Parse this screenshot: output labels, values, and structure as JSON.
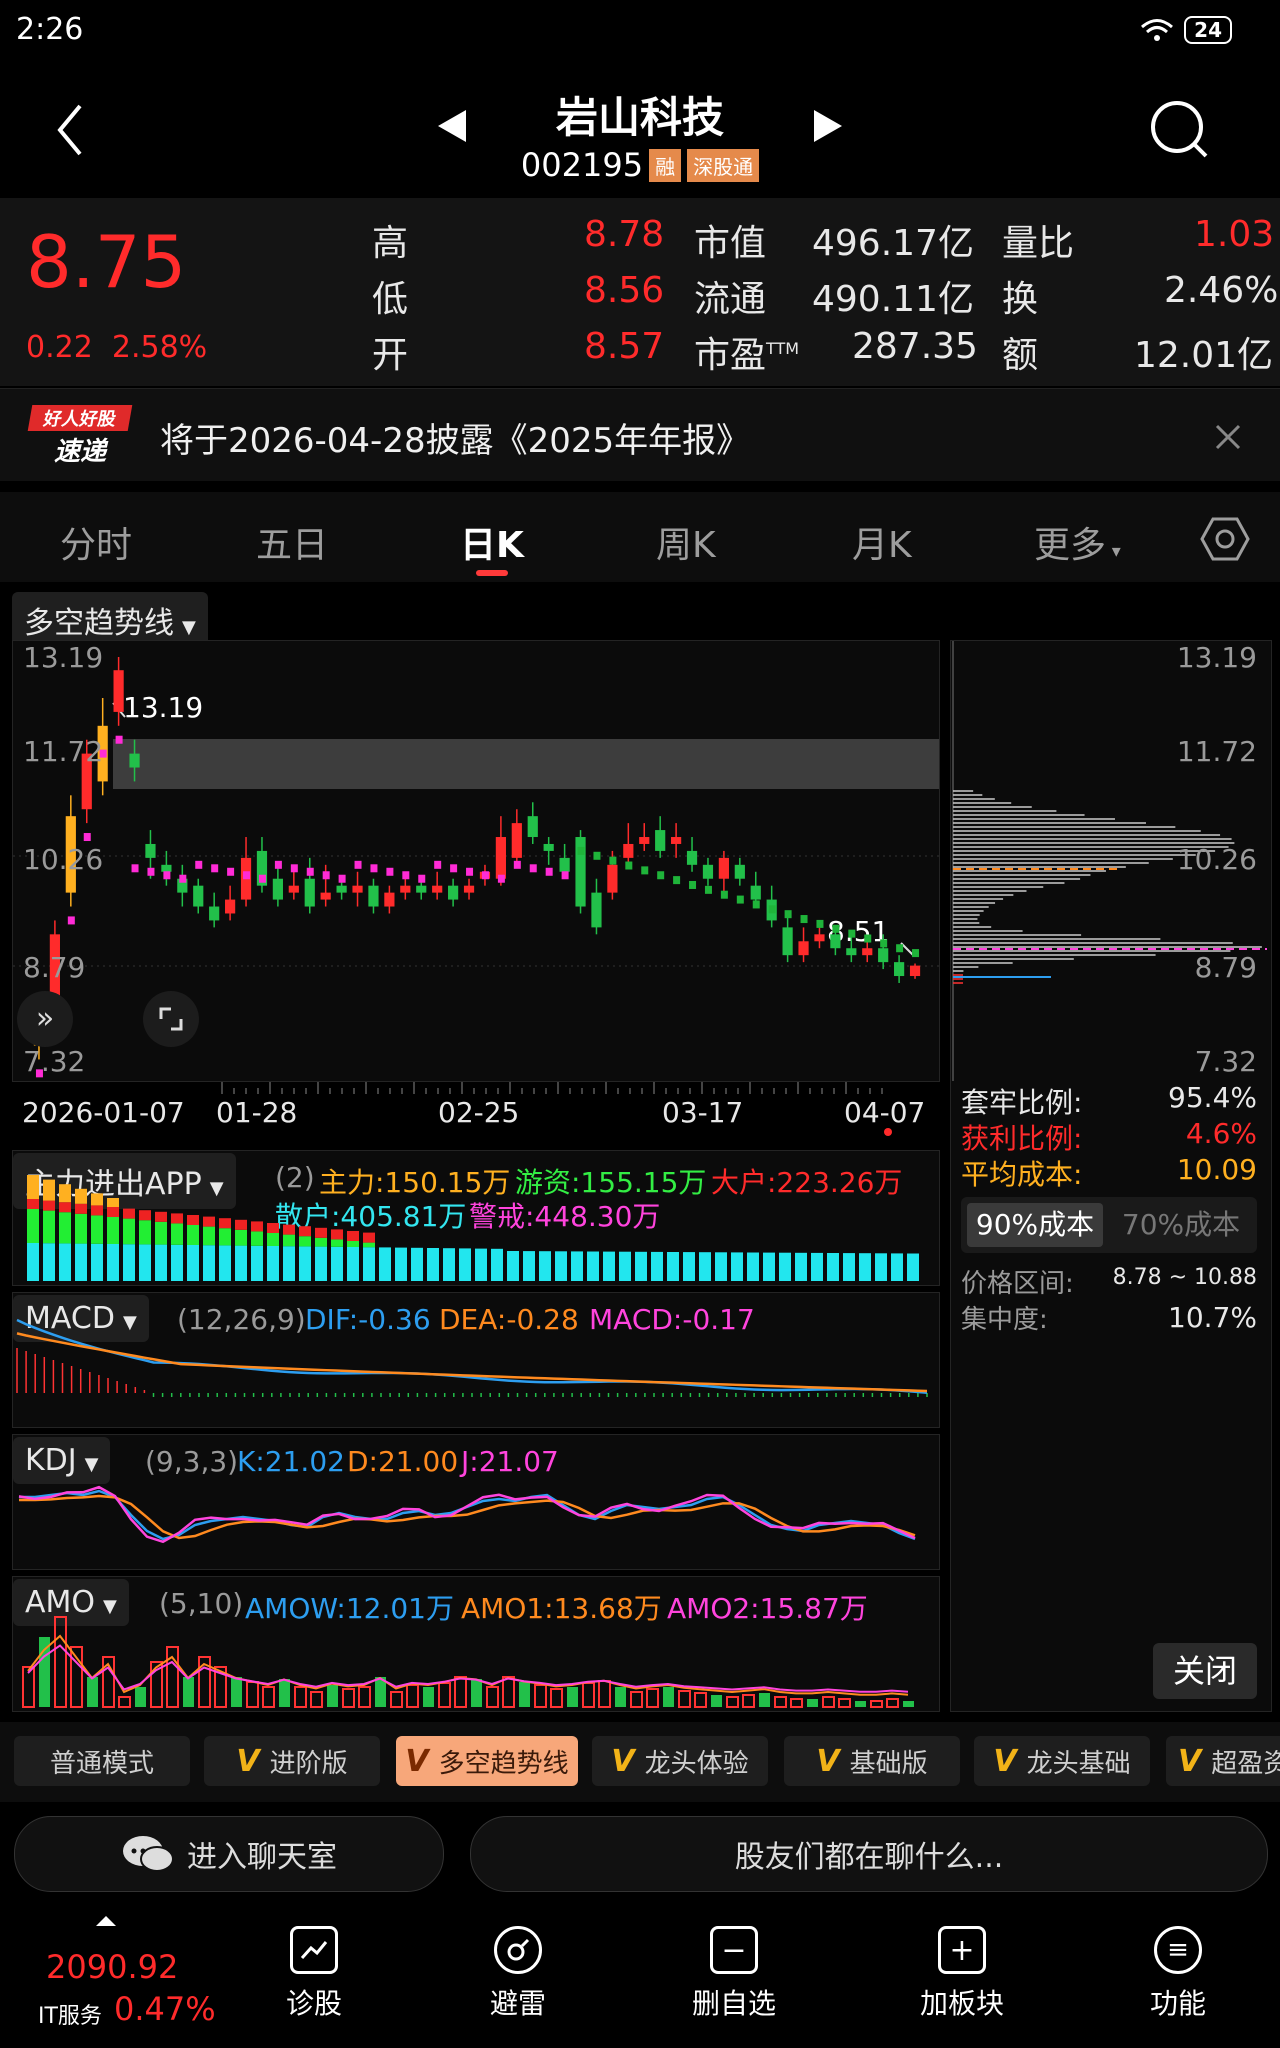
{
  "status": {
    "time": "2:26",
    "battery": "24"
  },
  "header": {
    "name": "岩山科技",
    "code": "002195",
    "tag1": "融",
    "tag2": "深股通"
  },
  "quote": {
    "price": "8.75",
    "change": "0.22",
    "change_pct": "2.58%",
    "high_label": "高",
    "high": "8.78",
    "low_label": "低",
    "low": "8.56",
    "open_label": "开",
    "open": "8.57",
    "mcap_label": "市值",
    "mcap": "496.17亿",
    "float_label": "流通",
    "float": "490.11亿",
    "pe_label": "市盈",
    "pe_sup": "TTM",
    "pe": "287.35",
    "vr_label": "量比",
    "vr": "1.03",
    "turn_label": "换",
    "turn": "2.46%",
    "amt_label": "额",
    "amt": "12.01亿"
  },
  "notice": {
    "logo_top": "好人好股",
    "logo_bottom": "速递",
    "text": "将于2026-04-28披露《2025年年报》"
  },
  "tabs": [
    {
      "label": "分时"
    },
    {
      "label": "五日"
    },
    {
      "label": "日K"
    },
    {
      "label": "周K"
    },
    {
      "label": "月K"
    },
    {
      "label": "更多"
    }
  ],
  "kchart": {
    "indicator": "多空趋势线",
    "y_labels": [
      "13.19",
      "11.72",
      "10.26",
      "8.79",
      "7.32"
    ],
    "high_marker": "13.19",
    "low_marker": "8.51",
    "dates": [
      "2026-01-07",
      "01-28",
      "02-25",
      "03-17",
      "04-07"
    ],
    "colors": {
      "up": "#ff2b2b",
      "down": "#22c04a",
      "trend_up": "#ff2bd6",
      "trend_down": "#1fb43a",
      "yellow": "#ffb020"
    }
  },
  "chip": {
    "y_labels": [
      "13.19",
      "11.72",
      "10.26",
      "8.79",
      "7.32"
    ],
    "trap_label": "套牢比例:",
    "trap": "95.4%",
    "profit_label": "获利比例:",
    "profit": "4.6%",
    "avg_label": "平均成本:",
    "avg": "10.09",
    "btn90": "90%成本",
    "btn70": "70%成本",
    "range_label": "价格区间:",
    "range": "8.78 ~ 10.88",
    "conc_label": "集中度:",
    "conc": "10.7%",
    "close": "关闭"
  },
  "mainflow": {
    "name": "主力进出APP",
    "param": "(2)",
    "main": "主力:150.15万",
    "hot": "游资:155.15万",
    "big": "大户:223.26万",
    "retail": "散户:405.81万",
    "alert": "警戒:448.30万"
  },
  "macd": {
    "name": "MACD",
    "param": "(12,26,9)",
    "dif": "DIF:-0.36",
    "dea": "DEA:-0.28",
    "macd": "MACD:-0.17"
  },
  "kdj": {
    "name": "KDJ",
    "param": "(9,3,3)",
    "k": "K:21.02",
    "d": "D:21.00",
    "j": "J:21.07"
  },
  "amo": {
    "name": "AMO",
    "param": "(5,10)",
    "amow": "AMOW:12.01万",
    "amo1": "AMO1:13.68万",
    "amo2": "AMO2:15.87万"
  },
  "modes": [
    {
      "label": "普通模式",
      "v": false
    },
    {
      "label": "进阶版",
      "v": true
    },
    {
      "label": "多空趋势线",
      "v": true,
      "active": true
    },
    {
      "label": "龙头体验",
      "v": true
    },
    {
      "label": "基础版",
      "v": true
    },
    {
      "label": "龙头基础",
      "v": true
    },
    {
      "label": "超盈资",
      "v": true
    }
  ],
  "chat": {
    "room": "进入聊天室",
    "prompt": "股友们都在聊什么..."
  },
  "index": {
    "value": "2090.92",
    "name": "IT服务",
    "pct": "0.47%"
  },
  "nav": [
    {
      "label": "诊股"
    },
    {
      "label": "避雷"
    },
    {
      "label": "删自选"
    },
    {
      "label": "加板块"
    },
    {
      "label": "功能"
    }
  ]
}
